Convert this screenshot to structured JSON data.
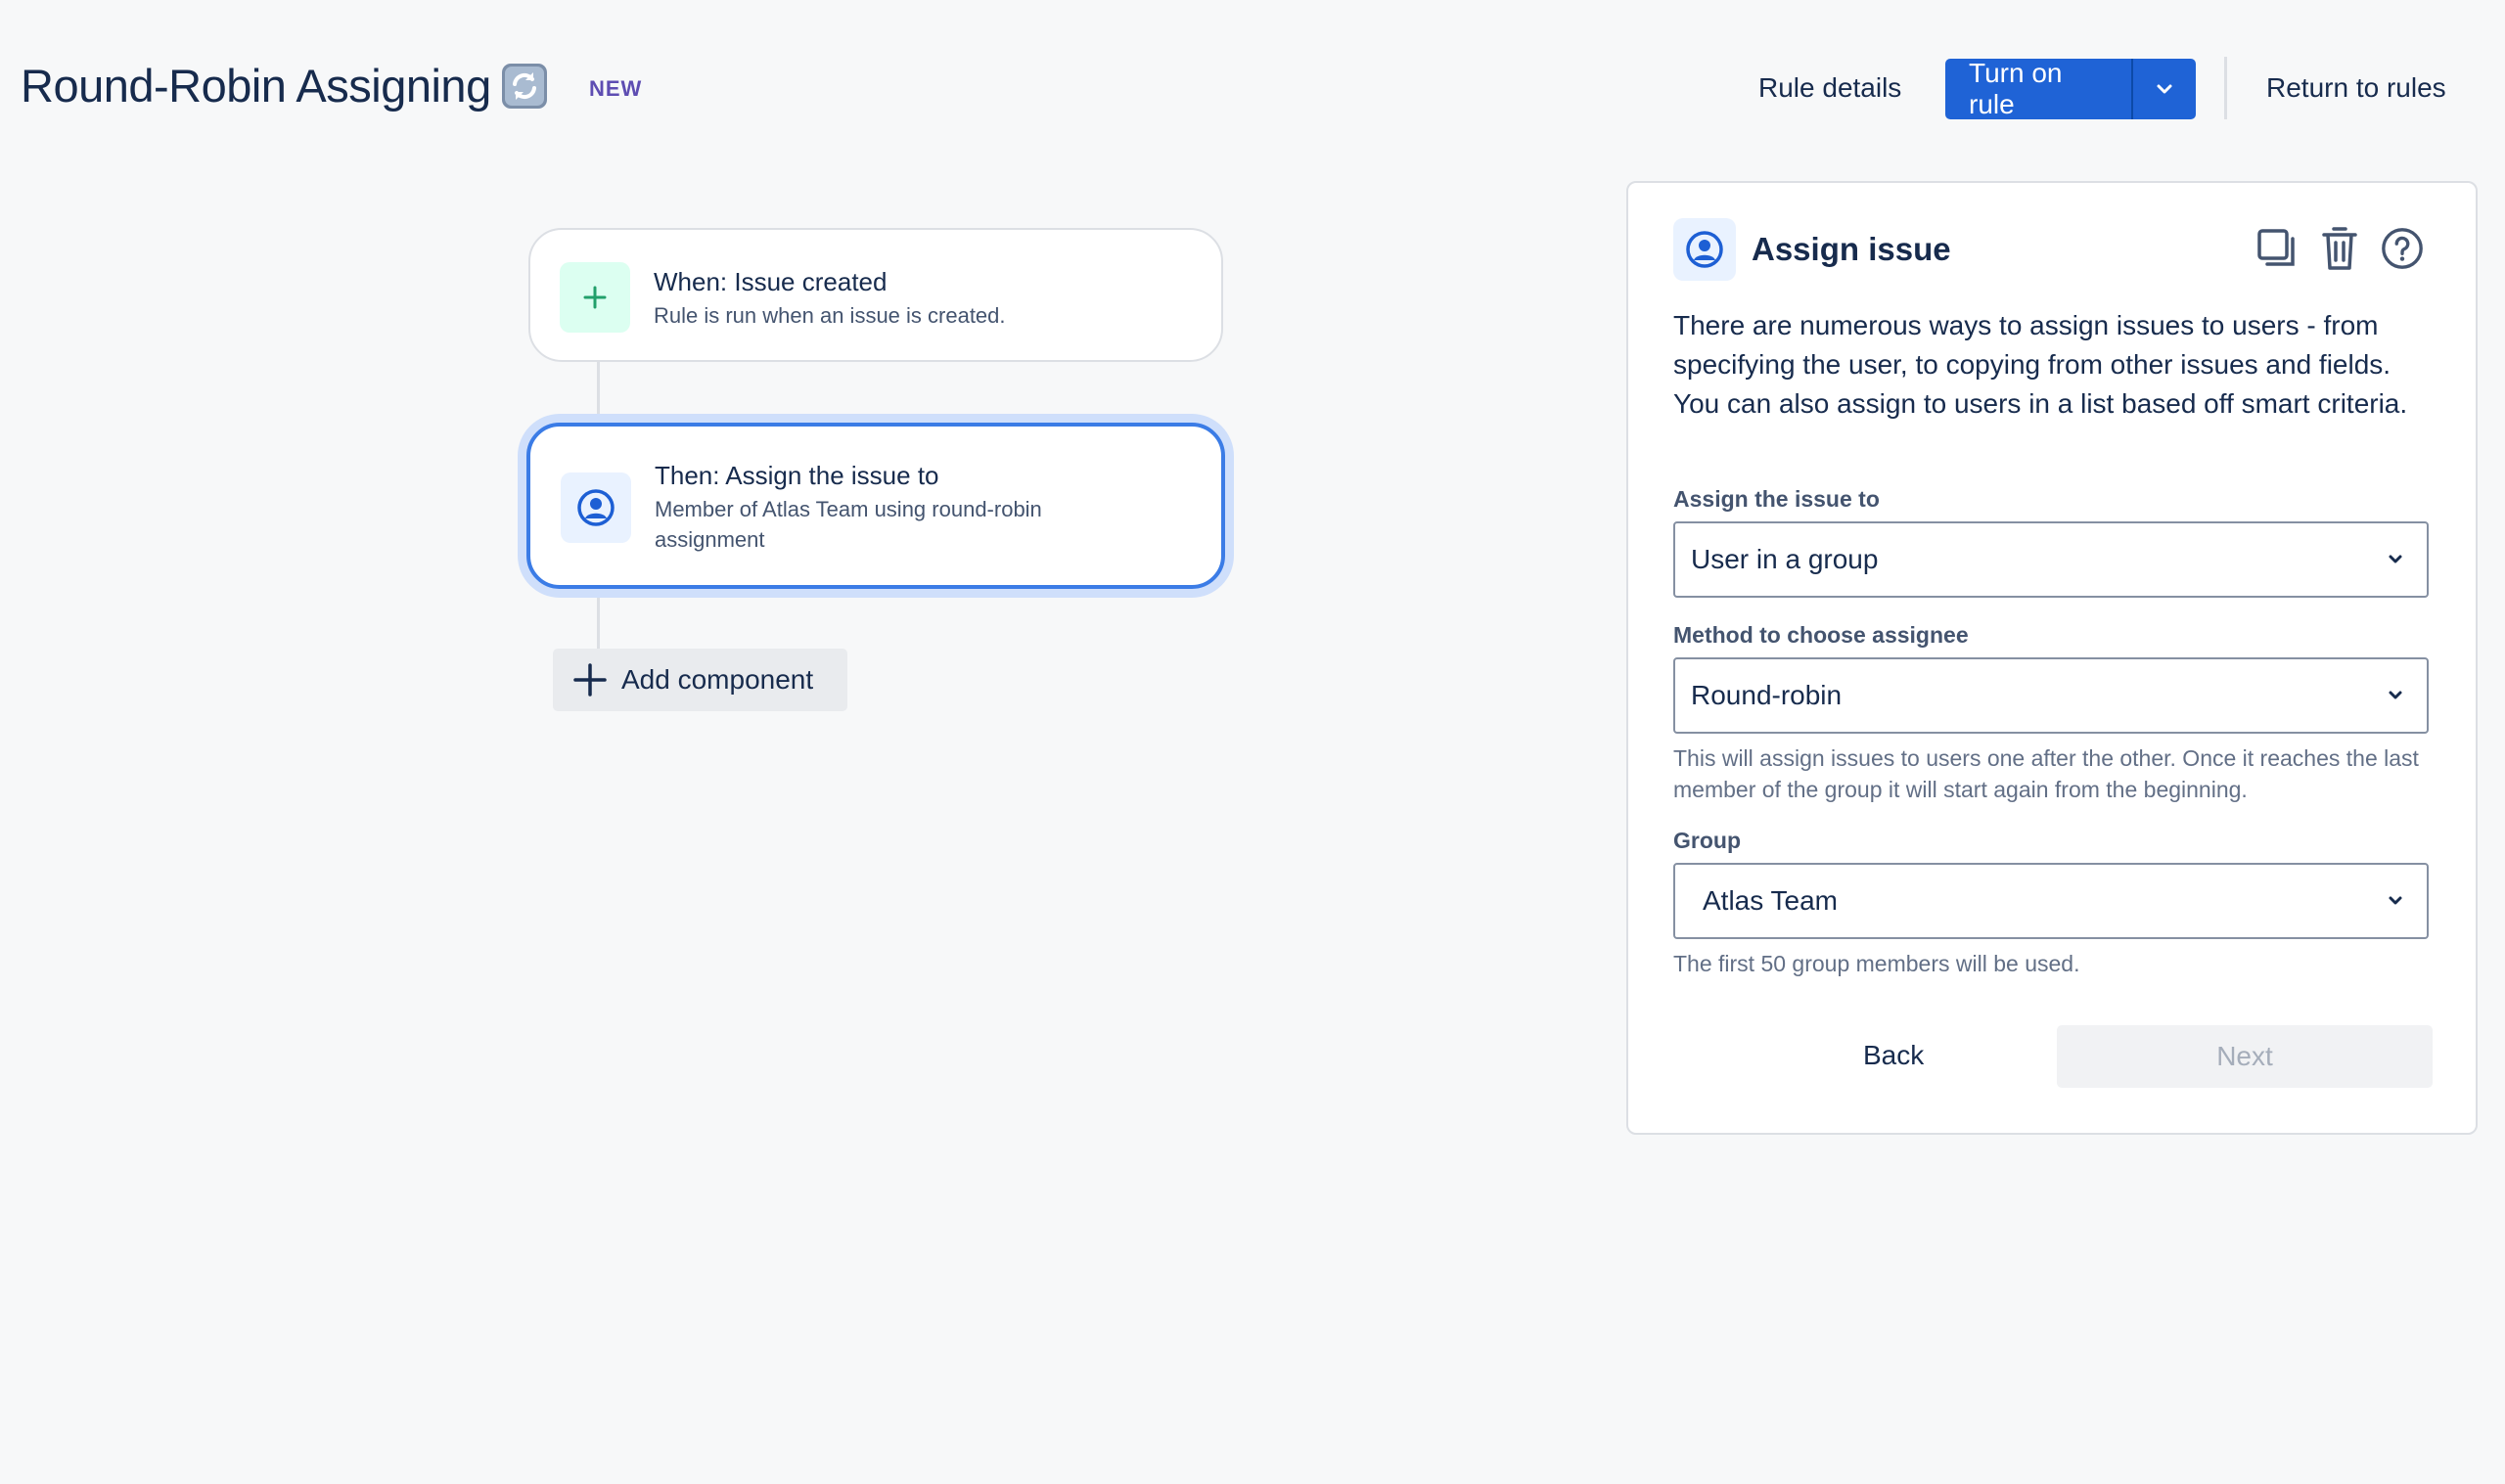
{
  "header": {
    "title": "Round-Robin Assigning",
    "title_emoji": "🔄",
    "badge": "NEW",
    "rule_details": "Rule details",
    "turn_on_rule": "Turn on rule",
    "return_to_rules": "Return to rules"
  },
  "flow": {
    "trigger": {
      "title": "When: Issue created",
      "subtitle": "Rule is run when an issue is created.",
      "icon": "plus-icon"
    },
    "action": {
      "title": "Then: Assign the issue to",
      "subtitle": "Member of Atlas Team using round-robin assignment",
      "icon": "user-avatar-icon"
    },
    "add_component": "Add component"
  },
  "panel": {
    "title": "Assign issue",
    "description": "There are numerous ways to assign issues to users - from specifying the user, to copying from other issues and fields. You can also assign to users in a list based off smart criteria.",
    "fields": {
      "assign_to": {
        "label": "Assign the issue to",
        "value": "User in a group"
      },
      "method": {
        "label": "Method to choose assignee",
        "value": "Round-robin",
        "helper": "This will assign issues to users one after the other. Once it reaches the last member of the group it will start again from the beginning."
      },
      "group": {
        "label": "Group",
        "value": "Atlas Team",
        "helper": "The first 50 group members will be used."
      }
    },
    "back": "Back",
    "next": "Next"
  },
  "colors": {
    "primary": "#1f63d6",
    "selected_border": "#3b7ce6",
    "badge_new": "#5e4db2",
    "trigger_icon_bg": "#dcfff1",
    "action_icon_bg": "#e9f2ff"
  }
}
